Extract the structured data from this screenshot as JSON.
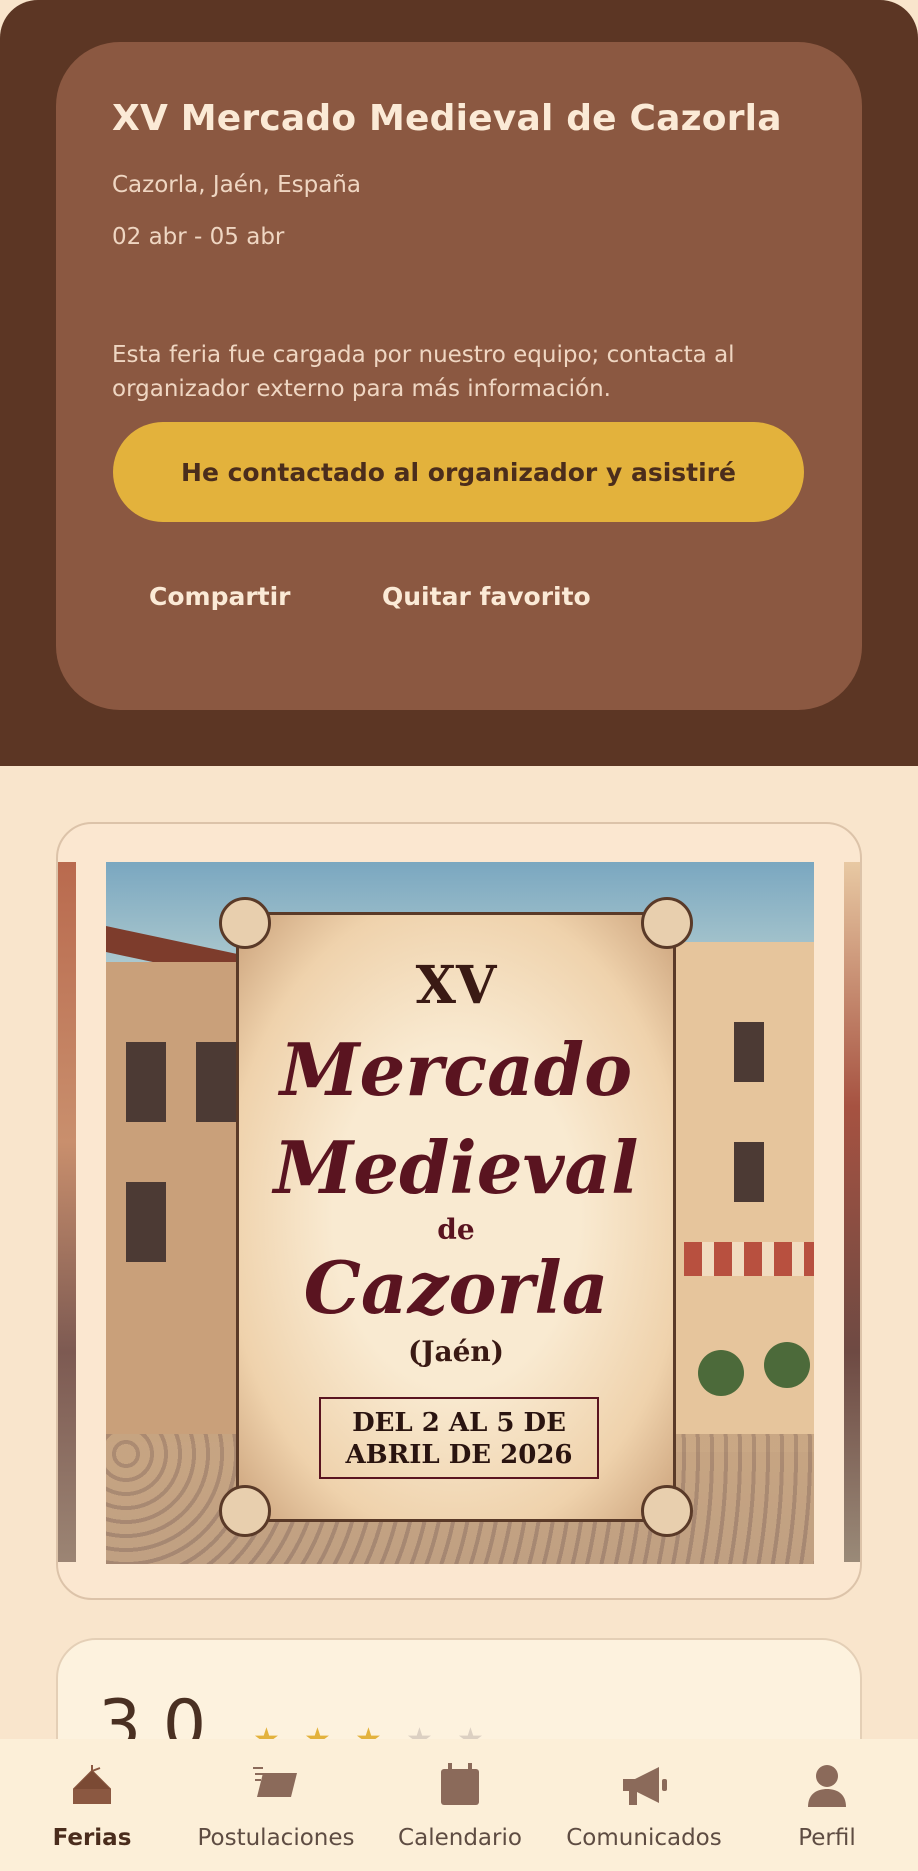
{
  "event": {
    "title": "XV Mercado Medieval de Cazorla",
    "location": "Cazorla, Jaén, España",
    "dates": "02 abr - 05 abr",
    "note": "Esta feria fue cargada por nuestro equipo; contacta al organizador externo para más información.",
    "contact_button": "He contactado al organizador y asistiré",
    "share_label": "Compartir",
    "unfavorite_label": "Quitar favorito"
  },
  "poster": {
    "edition": "XV",
    "line1": "Mercado",
    "line2": "Medieval",
    "de": "de",
    "line3": "Cazorla",
    "region": "(Jaén)",
    "dates_line1": "DEL 2 AL 5 DE",
    "dates_line2": "ABRIL DE 2026"
  },
  "rating": {
    "value": "3.0",
    "stars_filled": 3,
    "stars_total": 5
  },
  "nav": {
    "items": [
      {
        "label": "Ferias",
        "icon": "tent-icon",
        "active": true
      },
      {
        "label": "Postulaciones",
        "icon": "ticket-icon",
        "active": false
      },
      {
        "label": "Calendario",
        "icon": "calendar-icon",
        "active": false
      },
      {
        "label": "Comunicados",
        "icon": "megaphone-icon",
        "active": false
      },
      {
        "label": "Perfil",
        "icon": "person-icon",
        "active": false
      }
    ]
  },
  "colors": {
    "header_bg": "#5c3624",
    "card_bg": "#8b5841",
    "accent": "#e3b23c",
    "page_bg": "#f9e5cc"
  }
}
